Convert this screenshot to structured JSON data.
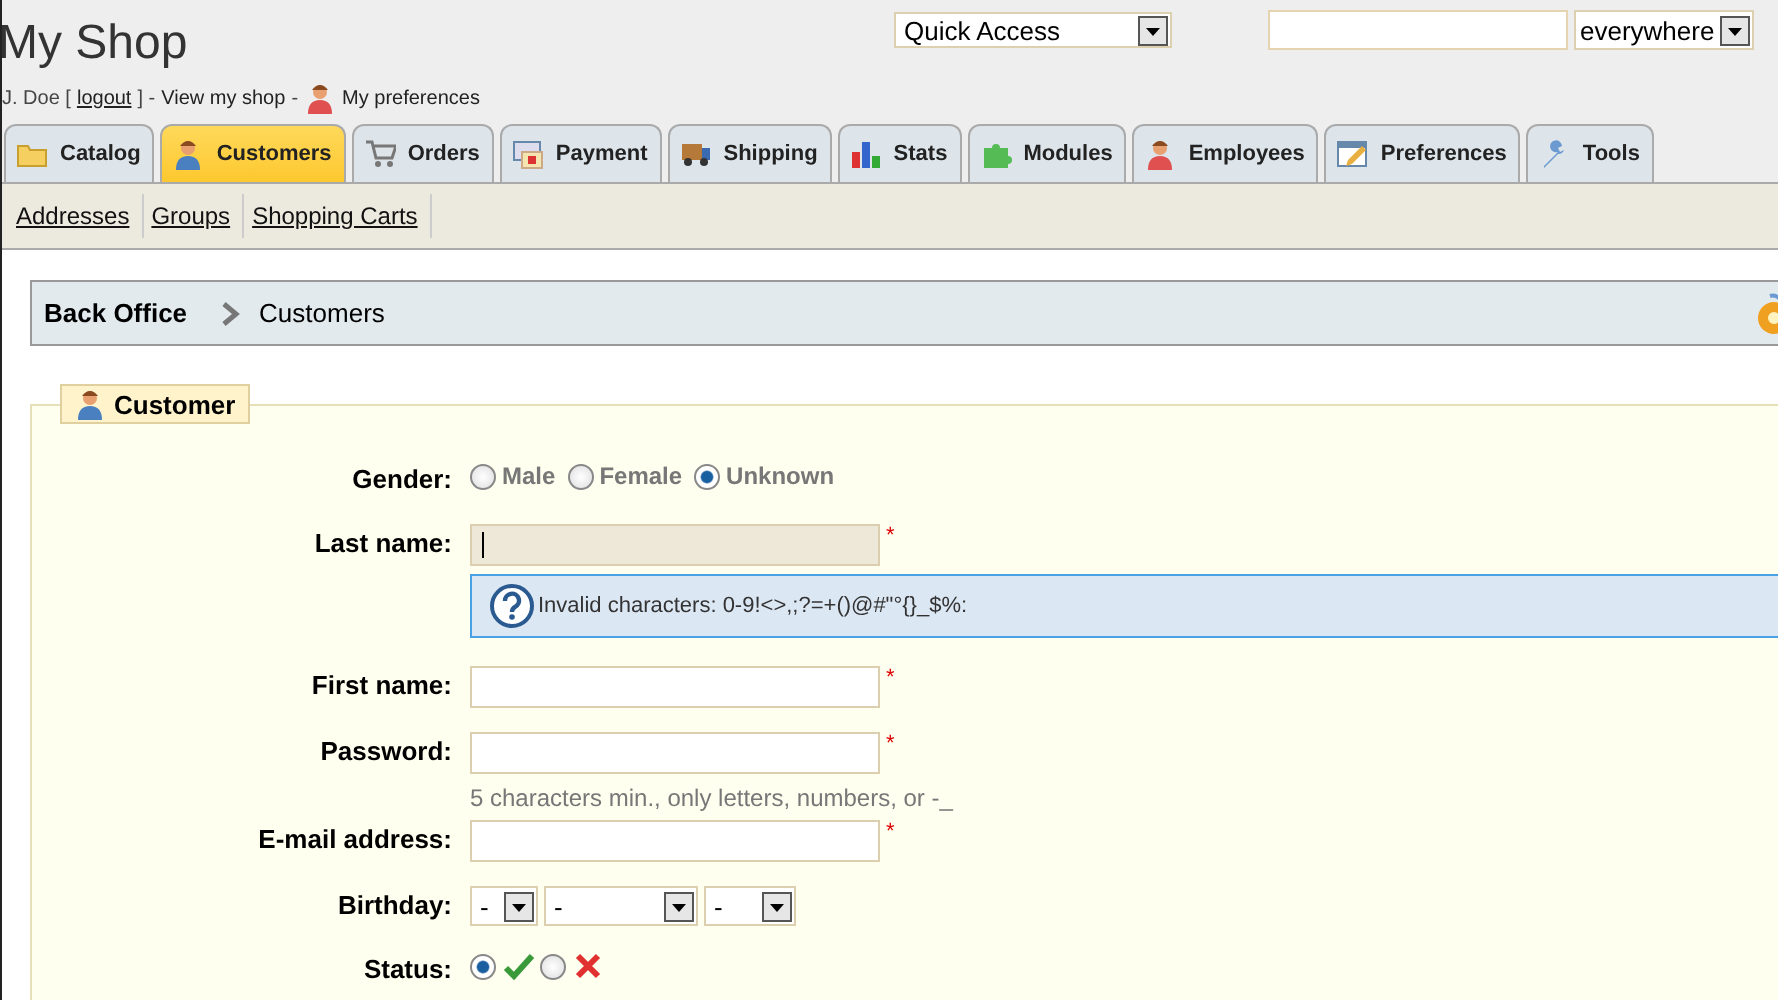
{
  "header": {
    "title": "My Shop",
    "user_line": {
      "user": "J. Doe [",
      "logout": "logout",
      "sep1": "] -",
      "view_shop": "View my shop",
      "sep2": "-",
      "preferences": "My preferences"
    },
    "quick_access": {
      "value": "Quick Access"
    },
    "search": {
      "scope": "everywhere"
    }
  },
  "tabs": [
    {
      "label": "Catalog",
      "selected": false
    },
    {
      "label": "Customers",
      "selected": true
    },
    {
      "label": "Orders",
      "selected": false
    },
    {
      "label": "Payment",
      "selected": false
    },
    {
      "label": "Shipping",
      "selected": false
    },
    {
      "label": "Stats",
      "selected": false
    },
    {
      "label": "Modules",
      "selected": false
    },
    {
      "label": "Employees",
      "selected": false
    },
    {
      "label": "Preferences",
      "selected": false
    },
    {
      "label": "Tools",
      "selected": false
    }
  ],
  "subtabs": [
    "Addresses",
    "Groups",
    "Shopping Carts"
  ],
  "breadcrumb": [
    "Back Office",
    "Customers"
  ],
  "form": {
    "legend": "Customer",
    "fields": [
      {
        "kind": "radio",
        "label": "Gender:",
        "options": [
          {
            "label": "Male",
            "selected": false
          },
          {
            "label": "Female",
            "selected": false
          },
          {
            "label": "Unknown",
            "selected": true
          }
        ]
      },
      {
        "kind": "text",
        "label": "Last name:",
        "required_mark": "*",
        "focused": true,
        "tooltip": "Invalid characters: 0-9!<>,;?=+()@#\"°{}_$%:"
      },
      {
        "kind": "text",
        "label": "First name:",
        "required_mark": "*",
        "focused": false
      },
      {
        "kind": "text",
        "label": "Password:",
        "required_mark": "*",
        "focused": false,
        "note": "5 characters min., only letters, numbers, or -_"
      },
      {
        "kind": "text",
        "label": "E-mail address:",
        "required_mark": "*",
        "focused": false
      },
      {
        "kind": "date",
        "label": "Birthday:",
        "selects": [
          "-",
          "-",
          "-"
        ]
      },
      {
        "kind": "status",
        "label": "Status:",
        "options": [
          {
            "selected": true
          },
          {
            "selected": false
          }
        ]
      }
    ]
  }
}
